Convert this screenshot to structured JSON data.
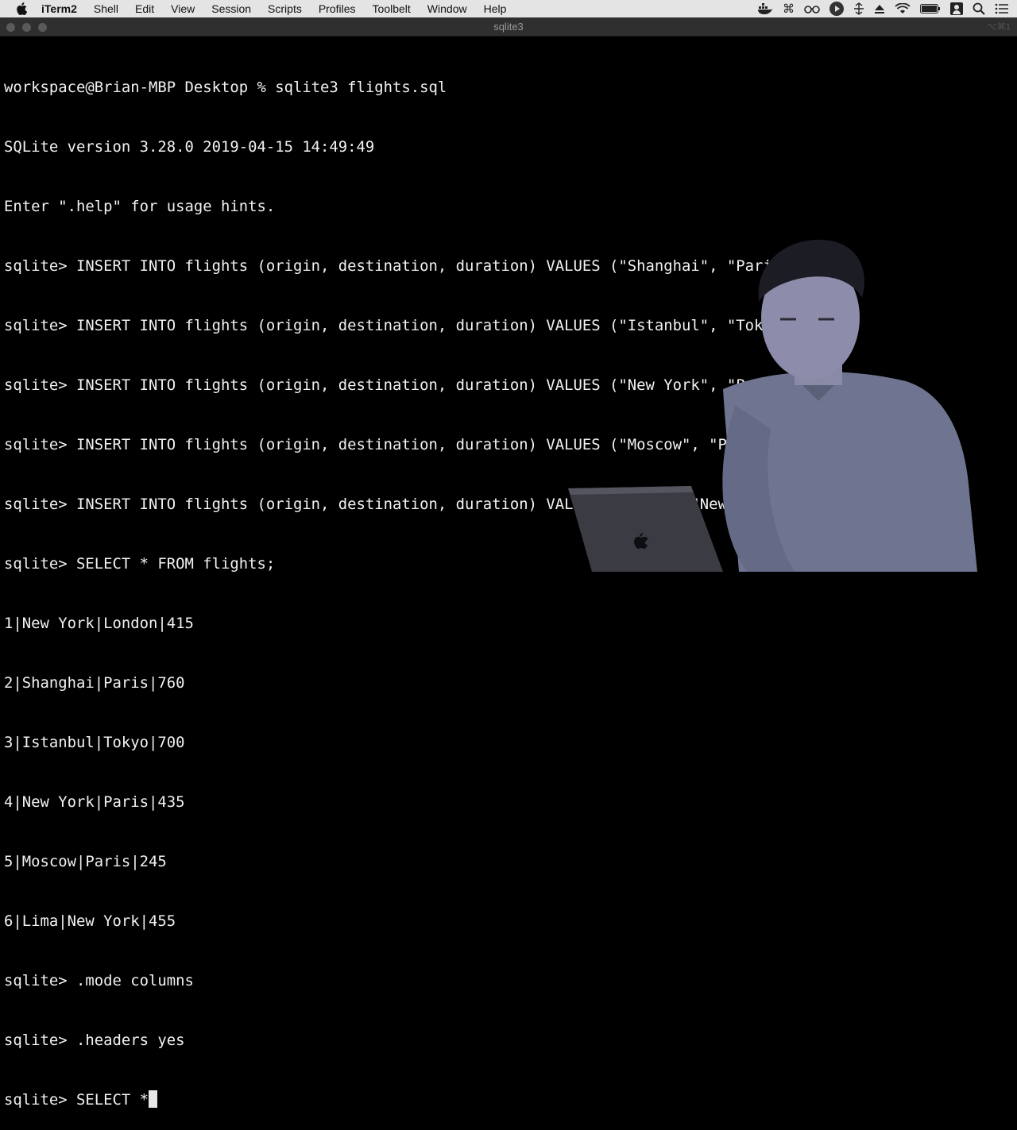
{
  "menubar": {
    "items": [
      "iTerm2",
      "Shell",
      "Edit",
      "View",
      "Session",
      "Scripts",
      "Profiles",
      "Toolbelt",
      "Window",
      "Help"
    ],
    "status_icons": [
      "docker-icon",
      "command-icon",
      "glasses-icon",
      "play-icon",
      "scroll-icon",
      "eject-icon",
      "wifi-icon",
      "battery-icon",
      "user-icon",
      "search-icon",
      "list-icon"
    ]
  },
  "window": {
    "title": "sqlite3",
    "shortcut": "⌥⌘1"
  },
  "terminal": {
    "lines": [
      "workspace@Brian-MBP Desktop % sqlite3 flights.sql",
      "SQLite version 3.28.0 2019-04-15 14:49:49",
      "Enter \".help\" for usage hints.",
      "sqlite> INSERT INTO flights (origin, destination, duration) VALUES (\"Shanghai\", \"Paris\", 760);",
      "sqlite> INSERT INTO flights (origin, destination, duration) VALUES (\"Istanbul\", \"Tokyo\", 700);",
      "sqlite> INSERT INTO flights (origin, destination, duration) VALUES (\"New York\", \"Paris\", 435);",
      "sqlite> INSERT INTO flights (origin, destination, duration) VALUES (\"Moscow\", \"Paris\", 245);",
      "sqlite> INSERT INTO flights (origin, destination, duration) VALUES (\"Lima\", \"New York\", 455);",
      "sqlite> SELECT * FROM flights;",
      "1|New York|London|415",
      "2|Shanghai|Paris|760",
      "3|Istanbul|Tokyo|700",
      "4|New York|Paris|435",
      "5|Moscow|Paris|245",
      "6|Lima|New York|455",
      "sqlite> .mode columns",
      "sqlite> .headers yes"
    ],
    "current_input": "sqlite> SELECT *"
  }
}
